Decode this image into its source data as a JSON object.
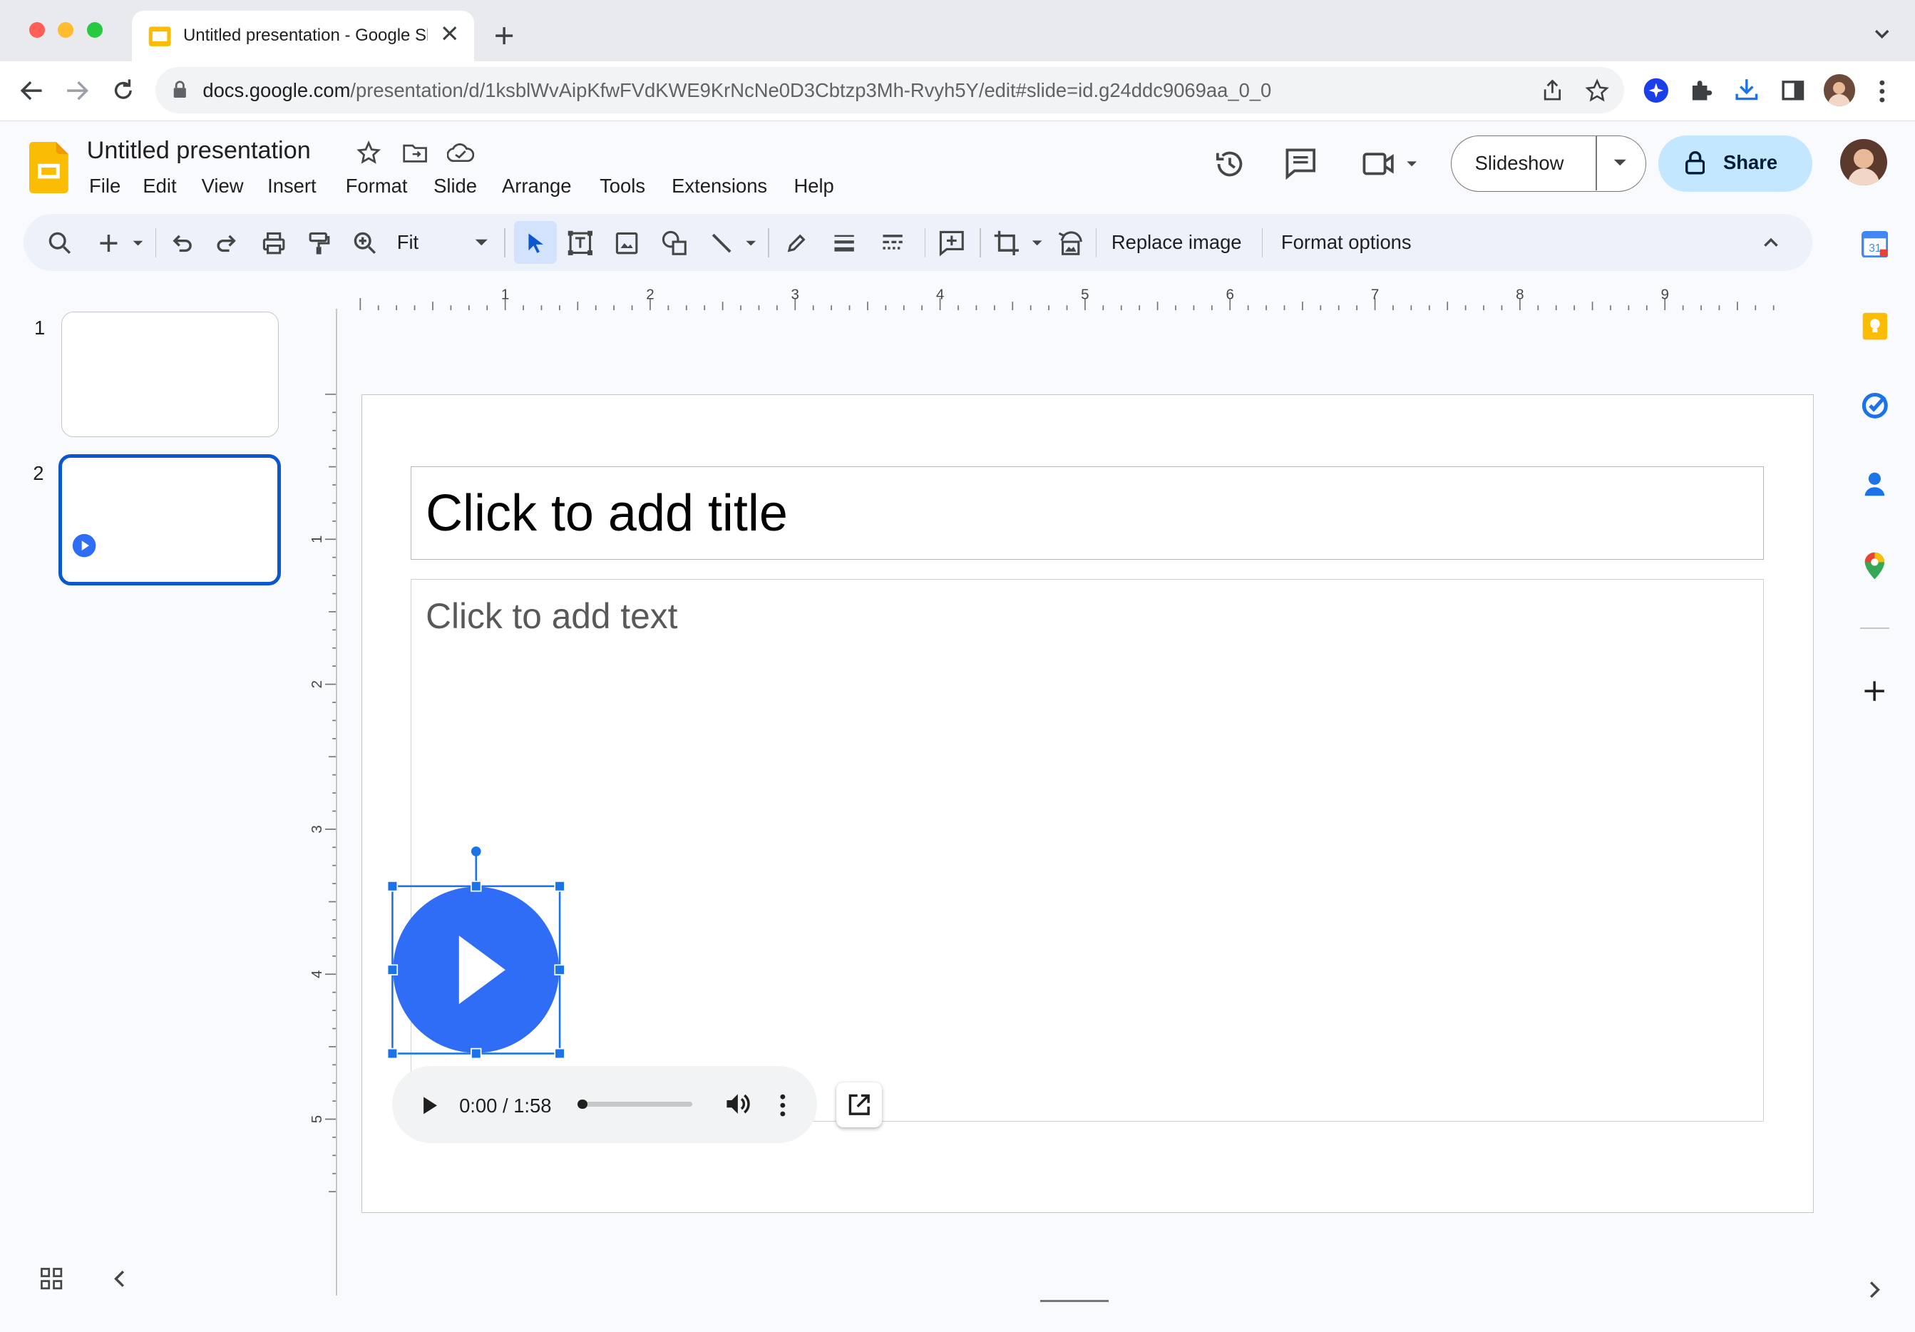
{
  "browser": {
    "tab_title": "Untitled presentation - Google Slides",
    "url_host": "docs.google.com",
    "url_path": "/presentation/d/1ksblWvAipKfwFVdKWE9KrNcNe0D3Cbtzp3Mh-Rvyh5Y/edit#slide=id.g24ddc9069aa_0_0"
  },
  "doc": {
    "title": "Untitled presentation",
    "menu": [
      "File",
      "Edit",
      "View",
      "Insert",
      "Format",
      "Slide",
      "Arrange",
      "Tools",
      "Extensions",
      "Help"
    ],
    "slideshow_label": "Slideshow",
    "share_label": "Share"
  },
  "toolbar": {
    "zoom_label": "Fit",
    "replace_image_label": "Replace image",
    "format_options_label": "Format options"
  },
  "ruler": {
    "horizontal": [
      "1",
      "2",
      "3",
      "4",
      "5",
      "6",
      "7",
      "8",
      "9"
    ],
    "vertical": [
      "1",
      "2",
      "3",
      "4",
      "5"
    ]
  },
  "filmstrip": {
    "slides": [
      "1",
      "2"
    ],
    "selected_index": 2
  },
  "slide": {
    "title_placeholder": "Click to add title",
    "body_placeholder": "Click to add text"
  },
  "audio": {
    "time": "0:00 / 1:58",
    "progress": 0
  },
  "colors": {
    "accent_blue": "#2f6df6",
    "selection_blue": "#1a73e8",
    "share_bg": "#c2e7ff",
    "slides_yellow": "#fbbc04"
  },
  "icons": {
    "side_panel": [
      "calendar-icon",
      "keep-icon",
      "tasks-icon",
      "contacts-icon",
      "maps-icon",
      "add-icon"
    ]
  }
}
